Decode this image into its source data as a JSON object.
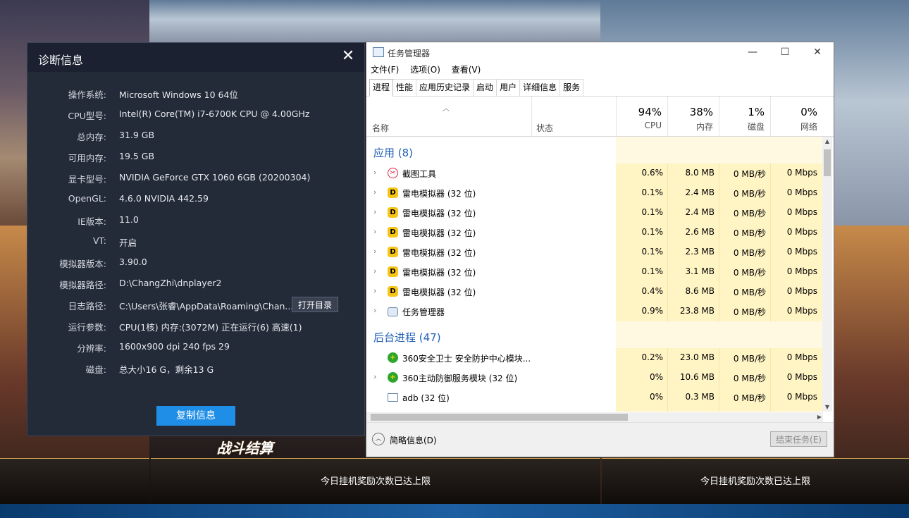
{
  "background": {
    "reward_limit_text": "今日挂机奖励次数已达上限",
    "battle_banner": "战斗结算"
  },
  "diagnostics": {
    "title": "诊断信息",
    "rows": [
      {
        "label": "操作系统:",
        "value": "Microsoft Windows 10 64位"
      },
      {
        "label": "CPU型号:",
        "value": "Intel(R) Core(TM) i7-6700K CPU @ 4.00GHz"
      },
      {
        "label": "总内存:",
        "value": "31.9 GB"
      },
      {
        "label": "可用内存:",
        "value": "19.5 GB"
      },
      {
        "label": "显卡型号:",
        "value": "NVIDIA GeForce GTX 1060 6GB (20200304)"
      },
      {
        "label": "OpenGL:",
        "value": "4.6.0 NVIDIA 442.59"
      },
      {
        "label": "IE版本:",
        "value": "11.0"
      },
      {
        "label": "VT:",
        "value": "开启"
      },
      {
        "label": "模拟器版本:",
        "value": "3.90.0"
      },
      {
        "label": "模拟器路径:",
        "value": "D:\\ChangZhi\\dnplayer2"
      },
      {
        "label": "日志路径:",
        "value": "C:\\Users\\张睿\\AppData\\Roaming\\Chan..."
      },
      {
        "label": "运行参数:",
        "value": "CPU(1核) 内存:(3072M) 正在运行(6) 高速(1)"
      },
      {
        "label": "分辨率:",
        "value": "1600x900 dpi 240 fps 29"
      },
      {
        "label": "磁盘:",
        "value": "总大小16 G，剩余13 G"
      }
    ],
    "open_dir_label": "打开目录",
    "copy_label": "复制信息"
  },
  "taskmgr": {
    "title": "任务管理器",
    "menu": [
      "文件(F)",
      "选项(O)",
      "查看(V)"
    ],
    "tabs": [
      "进程",
      "性能",
      "应用历史记录",
      "启动",
      "用户",
      "详细信息",
      "服务"
    ],
    "columns": {
      "name": "名称",
      "status": "状态",
      "cpu": {
        "pct": "94%",
        "label": "CPU"
      },
      "mem": {
        "pct": "38%",
        "label": "内存"
      },
      "disk": {
        "pct": "1%",
        "label": "磁盘"
      },
      "net": {
        "pct": "0%",
        "label": "网络"
      }
    },
    "apps_header": "应用 (8)",
    "apps": [
      {
        "icon": "snip-icon",
        "name": "截图工具",
        "cpu": "0.6%",
        "mem": "8.0 MB",
        "disk": "0 MB/秒",
        "net": "0 Mbps"
      },
      {
        "icon": "ldplayer-icon",
        "name": "雷电模拟器 (32 位)",
        "cpu": "0.1%",
        "mem": "2.4 MB",
        "disk": "0 MB/秒",
        "net": "0 Mbps"
      },
      {
        "icon": "ldplayer-icon",
        "name": "雷电模拟器 (32 位)",
        "cpu": "0.1%",
        "mem": "2.4 MB",
        "disk": "0 MB/秒",
        "net": "0 Mbps"
      },
      {
        "icon": "ldplayer-icon",
        "name": "雷电模拟器 (32 位)",
        "cpu": "0.1%",
        "mem": "2.6 MB",
        "disk": "0 MB/秒",
        "net": "0 Mbps"
      },
      {
        "icon": "ldplayer-icon",
        "name": "雷电模拟器 (32 位)",
        "cpu": "0.1%",
        "mem": "2.3 MB",
        "disk": "0 MB/秒",
        "net": "0 Mbps"
      },
      {
        "icon": "ldplayer-icon",
        "name": "雷电模拟器 (32 位)",
        "cpu": "0.1%",
        "mem": "3.1 MB",
        "disk": "0 MB/秒",
        "net": "0 Mbps"
      },
      {
        "icon": "ldplayer-icon",
        "name": "雷电模拟器 (32 位)",
        "cpu": "0.4%",
        "mem": "8.6 MB",
        "disk": "0 MB/秒",
        "net": "0 Mbps"
      },
      {
        "icon": "taskmgr-icon",
        "name": "任务管理器",
        "cpu": "0.9%",
        "mem": "23.8 MB",
        "disk": "0 MB/秒",
        "net": "0 Mbps"
      }
    ],
    "bg_header": "后台进程 (47)",
    "bg": [
      {
        "icon": "360-icon",
        "name": "360安全卫士 安全防护中心模块...",
        "cpu": "0.2%",
        "mem": "23.0 MB",
        "disk": "0 MB/秒",
        "net": "0 Mbps",
        "expand": false
      },
      {
        "icon": "360-icon",
        "name": "360主动防御服务模块 (32 位)",
        "cpu": "0%",
        "mem": "10.6 MB",
        "disk": "0 MB/秒",
        "net": "0 Mbps",
        "expand": true
      },
      {
        "icon": "adb-icon",
        "name": "adb (32 位)",
        "cpu": "0%",
        "mem": "0.3 MB",
        "disk": "0 MB/秒",
        "net": "0 Mbps",
        "expand": false
      }
    ],
    "brief_label": "简略信息(D)",
    "end_task_label": "结束任务(E)"
  }
}
